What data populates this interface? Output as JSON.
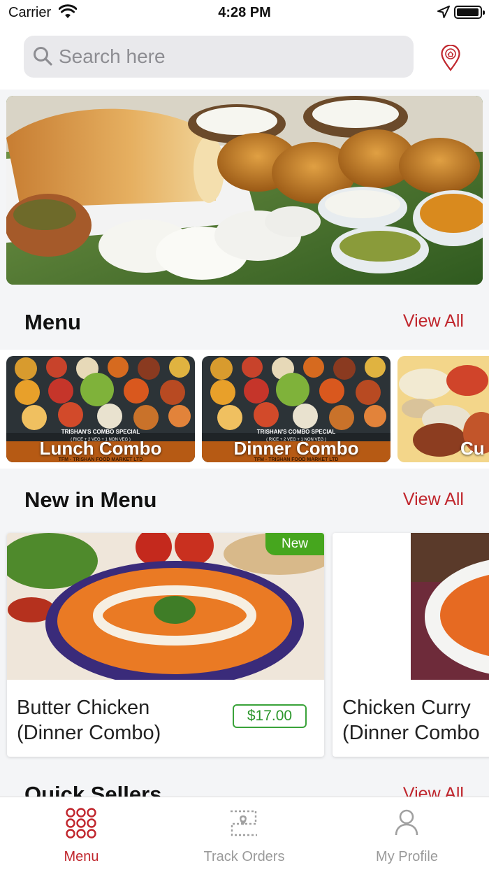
{
  "status_bar": {
    "carrier": "Carrier",
    "time": "4:28 PM"
  },
  "search": {
    "placeholder": "Search here",
    "value": ""
  },
  "sections": {
    "menu": {
      "title": "Menu",
      "link": "View All"
    },
    "new_in_menu": {
      "title": "New in Menu",
      "link": "View All"
    },
    "quick_sellers": {
      "title": "Quick Sellers",
      "link": "View All"
    }
  },
  "menu_items": [
    {
      "label": "Lunch Combo"
    },
    {
      "label": "Dinner Combo"
    },
    {
      "label": "Cu"
    }
  ],
  "new_items": [
    {
      "name_line1": "Butter Chicken",
      "name_line2": "(Dinner Combo)",
      "price": "$17.00",
      "badge": "New"
    },
    {
      "name_line1": "Chicken Curry",
      "name_line2": "(Dinner Combo",
      "price": "",
      "badge": ""
    }
  ],
  "combo_sign": {
    "line1": "TRISHAN'S COMBO SPECIAL",
    "line2": "( RICE + 2 VEG + 1 NON VEG )",
    "line3": "TFM - TRISHAN FOOD MARKET LTD"
  },
  "tabs": [
    {
      "label": "Menu",
      "active": true
    },
    {
      "label": "Track Orders",
      "active": false
    },
    {
      "label": "My Profile",
      "active": false
    }
  ],
  "colors": {
    "accent": "#c0262d",
    "price_green": "#2b962b",
    "badge_green": "#46a61e"
  }
}
